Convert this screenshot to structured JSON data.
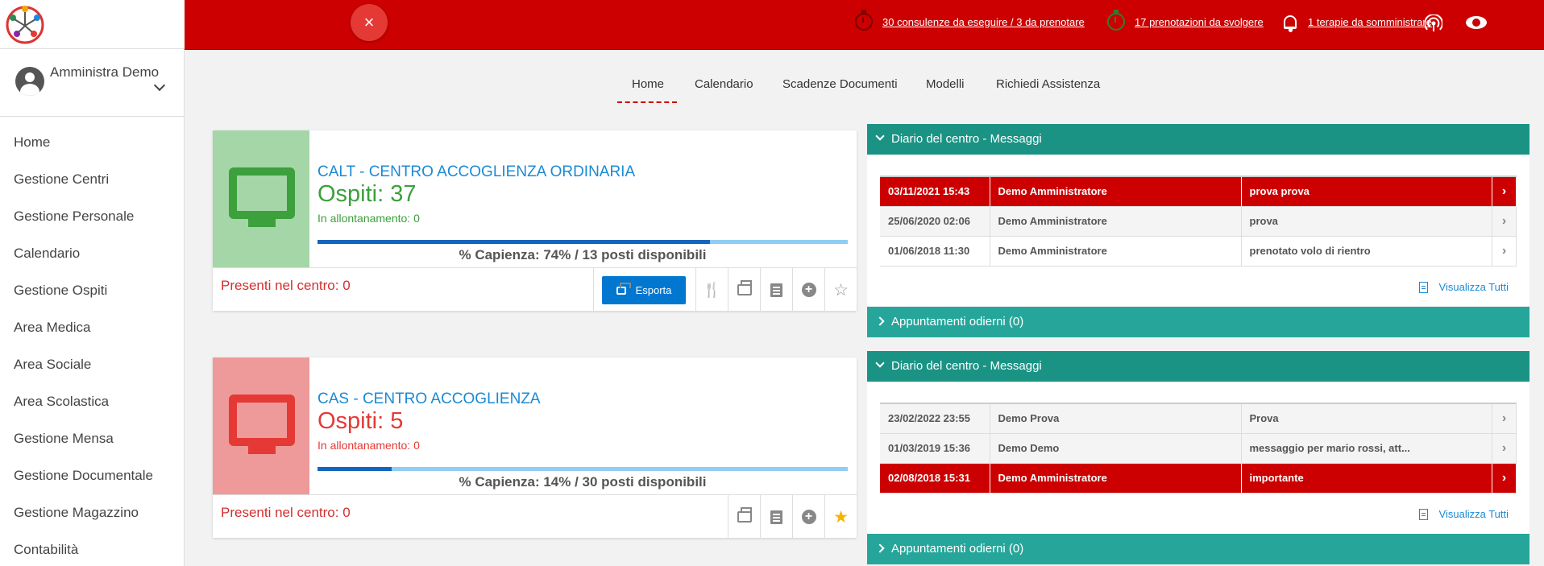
{
  "sidebar": {
    "user_name": "Amministra Demo",
    "items": [
      {
        "label": "Home"
      },
      {
        "label": "Gestione Centri"
      },
      {
        "label": "Gestione Personale"
      },
      {
        "label": "Calendario"
      },
      {
        "label": "Gestione Ospiti"
      },
      {
        "label": "Area Medica"
      },
      {
        "label": "Area Sociale"
      },
      {
        "label": "Area Scolastica"
      },
      {
        "label": "Gestione Mensa"
      },
      {
        "label": "Gestione Documentale"
      },
      {
        "label": "Gestione Magazzino"
      },
      {
        "label": "Contabilità"
      }
    ]
  },
  "header": {
    "close_icon": "×",
    "consulenze": "30 consulenze da eseguire / 3 da prenotare",
    "prenotazioni": "17 prenotazioni da svolgere",
    "terapie": "1 terapie da somministrare"
  },
  "tabs": [
    {
      "label": "Home"
    },
    {
      "label": "Calendario"
    },
    {
      "label": "Scadenze Documenti"
    },
    {
      "label": "Modelli"
    },
    {
      "label": "Richiedi Assistenza"
    }
  ],
  "centers": [
    {
      "title": "CALT - CENTRO ACCOGLIENZA ORDINARIA",
      "ospiti": "Ospiti: 37",
      "allontanamento": "In allontanamento: 0",
      "capacity_pct": 74,
      "capienza": "% Capienza: 74% / 13 posti disponibili",
      "presenti": "Presenti nel centro: 0",
      "export_label": "Esporta",
      "color": "#3ca03c",
      "side_bg": "#a5d6a7",
      "starred": false
    },
    {
      "title": "CAS - CENTRO ACCOGLIENZA",
      "ospiti": "Ospiti: 5",
      "allontanamento": "In allontanamento: 0",
      "capacity_pct": 14,
      "capienza": "% Capienza: 14% / 30 posti disponibili",
      "presenti": "Presenti nel centro: 0",
      "color": "#e53935",
      "side_bg": "#ef9a9a",
      "starred": true
    }
  ],
  "panels": [
    {
      "title": "Diario del centro - Messaggi",
      "rows": [
        {
          "date": "03/11/2021 15:43",
          "author": "Demo Amministratore",
          "message": "prova prova",
          "highlight": true
        },
        {
          "date": "25/06/2020 02:06",
          "author": "Demo Amministratore",
          "message": "prova",
          "highlight": false
        },
        {
          "date": "01/06/2018 11:30",
          "author": "Demo Amministratore",
          "message": "prenotato volo di rientro",
          "highlight": false
        }
      ],
      "view_all": "Visualizza Tutti",
      "appointments": "Appuntamenti odierni (0)"
    },
    {
      "title": "Diario del centro - Messaggi",
      "rows": [
        {
          "date": "23/02/2022 23:55",
          "author": "Demo Prova",
          "message": "Prova",
          "highlight": false
        },
        {
          "date": "01/03/2019 15:36",
          "author": "Demo Demo",
          "message": "messaggio per mario rossi, att...",
          "highlight": false
        },
        {
          "date": "02/08/2018 15:31",
          "author": "Demo Amministratore",
          "message": "importante",
          "highlight": true
        }
      ],
      "view_all": "Visualizza Tutti",
      "appointments": "Appuntamenti odierni (0)"
    }
  ]
}
